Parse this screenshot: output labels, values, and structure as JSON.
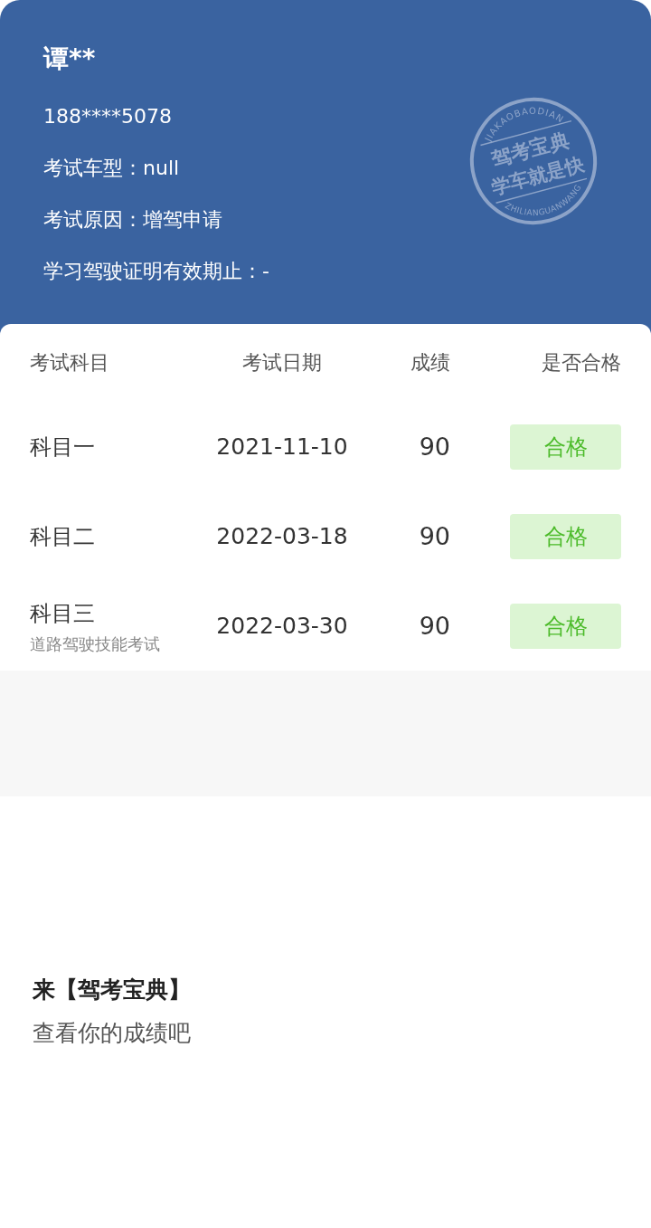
{
  "profile": {
    "name": "谭**",
    "phone": "188****5078",
    "fields": [
      "考试车型：null",
      "考试原因：增驾申请",
      "学习驾驶证明有效期止：-"
    ]
  },
  "seal": {
    "top_text": "JIAKAOBAODIAN",
    "title": "驾考宝典",
    "slogan": "学车就是快",
    "bottom_text": "ZHILIANGUANWANG"
  },
  "results": {
    "columns": [
      "考试科目",
      "考试日期",
      "成绩",
      "是否合格"
    ],
    "rows": [
      {
        "subject": "科目一",
        "date": "2021-11-10",
        "score": "90",
        "status": "合格",
        "passed": true
      },
      {
        "subject": "科目二",
        "date": "2022-03-18",
        "score": "90",
        "status": "合格",
        "passed": true
      },
      {
        "subject": "科目三",
        "subtitle": "道路驾驶技能考试",
        "date": "2022-03-30",
        "score": "90",
        "status": "合格",
        "passed": true
      }
    ]
  },
  "promo": {
    "title": "来【驾考宝典】",
    "subtitle": "查看你的成绩吧"
  }
}
